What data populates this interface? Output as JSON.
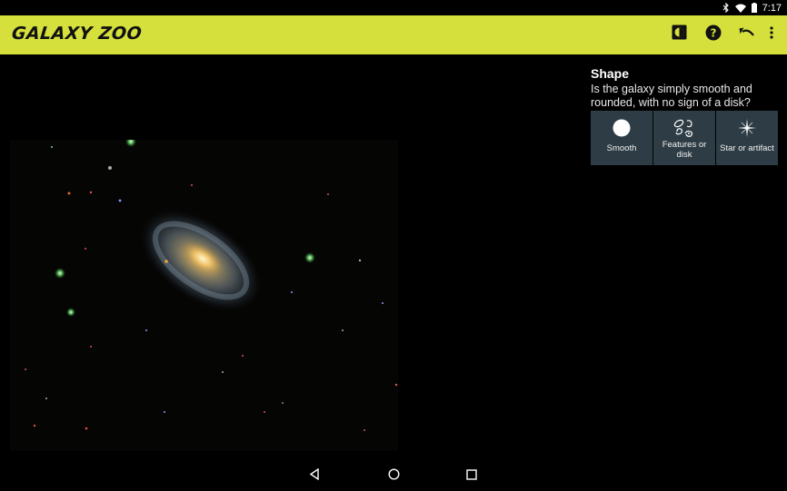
{
  "status_bar": {
    "time": "7:17",
    "icons": [
      "bluetooth-icon",
      "wifi-icon",
      "battery-icon"
    ]
  },
  "toolbar": {
    "title": "GALAXY ZOO",
    "background_color": "#d5e03c",
    "actions": [
      "contrast-icon",
      "help-icon",
      "undo-icon",
      "more-vert-icon"
    ]
  },
  "question": {
    "title": "Shape",
    "text": "Is the galaxy simply smooth and rounded, with no sign of a disk?",
    "answers": [
      {
        "label": "Smooth",
        "icon": "smooth-circle-icon"
      },
      {
        "label": "Features or disk",
        "icon": "features-spiral-icon"
      },
      {
        "label": "Star or artifact",
        "icon": "star-sparkle-icon"
      }
    ],
    "answer_background": "#2e3d45"
  },
  "nav_bar": {
    "buttons": [
      "back-icon",
      "home-icon",
      "recents-icon"
    ]
  }
}
